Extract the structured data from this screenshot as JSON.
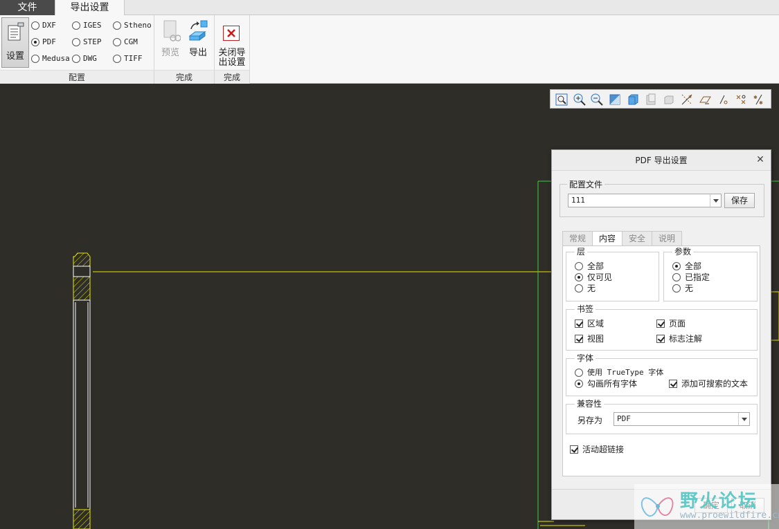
{
  "menu": {
    "file": "文件",
    "export_settings": "导出设置"
  },
  "ribbon": {
    "settings_label": "设置",
    "formats": [
      {
        "label": "DXF",
        "selected": false
      },
      {
        "label": "IGES",
        "selected": false
      },
      {
        "label": "Stheno",
        "selected": false
      },
      {
        "label": "PDF",
        "selected": true
      },
      {
        "label": "STEP",
        "selected": false
      },
      {
        "label": "CGM",
        "selected": false
      },
      {
        "label": "Medusa",
        "selected": false
      },
      {
        "label": "DWG",
        "selected": false
      },
      {
        "label": "TIFF",
        "selected": false
      }
    ],
    "group_config": "配置",
    "preview_label": "预览",
    "export_label": "导出",
    "group_finish": "完成",
    "close_label": "关闭导出设置",
    "group_finish2": "完成"
  },
  "toolbar": {
    "icons": [
      "refit-icon",
      "zoom-in-icon",
      "zoom-out-icon",
      "repaint-icon",
      "display-style-icon",
      "saved-views-icon",
      "view-manager-icon",
      "datum-axis-display-icon",
      "datum-plane-display-icon",
      "datum-point-display-icon",
      "csys-display-icon",
      "annotation-display-icon"
    ]
  },
  "dialog": {
    "title": "PDF 导出设置",
    "config_file_legend": "配置文件",
    "config_file_value": "111",
    "save_button": "保存",
    "tabs": [
      {
        "label": "常规",
        "active": false
      },
      {
        "label": "内容",
        "active": true
      },
      {
        "label": "安全",
        "active": false
      },
      {
        "label": "说明",
        "active": false
      }
    ],
    "layers": {
      "title": "层",
      "options": [
        {
          "label": "全部",
          "checked": false
        },
        {
          "label": "仅可见",
          "checked": true
        },
        {
          "label": "无",
          "checked": false
        }
      ]
    },
    "params": {
      "title": "参数",
      "options": [
        {
          "label": "全部",
          "checked": true
        },
        {
          "label": "已指定",
          "checked": false
        },
        {
          "label": "无",
          "checked": false
        }
      ]
    },
    "bookmarks": {
      "title": "书签",
      "region": "区域",
      "page": "页面",
      "view": "视图",
      "flag_note": "标志注解"
    },
    "fonts": {
      "title": "字体",
      "use_truetype": "使用 TrueType 字体",
      "stroke_all": "勾画所有字体",
      "add_searchable": "添加可搜索的文本"
    },
    "compat": {
      "title": "兼容性",
      "save_as_label": "另存为",
      "save_as_value": "PDF"
    },
    "hyperlinks": "活动超链接",
    "ok": "确定",
    "cancel": "取消"
  },
  "watermark": {
    "text": "野火论坛",
    "url": "www.proewildfire.cn"
  },
  "colors": {
    "canvas_bg": "#2e2d28",
    "drawing_line": "#ffff00",
    "drawing_outline": "#ffffff",
    "green_frame": "#40d040"
  }
}
